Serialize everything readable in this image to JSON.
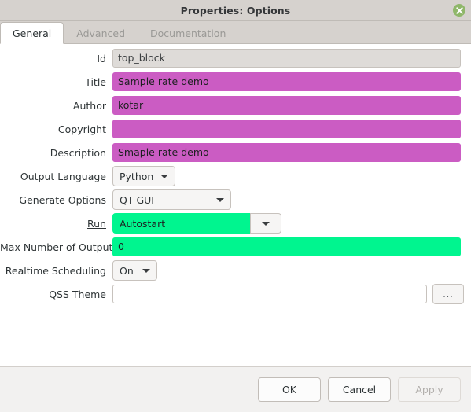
{
  "window": {
    "title": "Properties: Options",
    "close_icon": "close-circle-icon"
  },
  "tabs": [
    {
      "label": "General",
      "active": true
    },
    {
      "label": "Advanced",
      "active": false
    },
    {
      "label": "Documentation",
      "active": false
    }
  ],
  "form": {
    "rows": [
      {
        "label": "Id",
        "value": "top_block",
        "kind": "readonly-input"
      },
      {
        "label": "Title",
        "value": "Sample rate demo",
        "kind": "edited-input"
      },
      {
        "label": "Author",
        "value": "kotar",
        "kind": "edited-input"
      },
      {
        "label": "Copyright",
        "value": "",
        "kind": "edited-input"
      },
      {
        "label": "Description",
        "value": "Smaple rate demo",
        "kind": "edited-input"
      },
      {
        "label": "Output Language",
        "value": "Python",
        "kind": "combo"
      },
      {
        "label": "Generate Options",
        "value": "QT GUI",
        "kind": "combo"
      },
      {
        "label": "Run",
        "value": "Autostart",
        "kind": "combo-split",
        "underlined": true
      },
      {
        "label": "Max Number of Output",
        "value": "0",
        "kind": "green-input"
      },
      {
        "label": "Realtime Scheduling",
        "value": "On",
        "kind": "combo"
      },
      {
        "label": "QSS Theme",
        "value": "",
        "kind": "file-input",
        "browse_label": "..."
      }
    ]
  },
  "footer": {
    "ok_label": "OK",
    "cancel_label": "Cancel",
    "apply_label": "Apply"
  },
  "colors": {
    "edited_field": "#cb5cc3",
    "green_field": "#00f58f",
    "readonly_field": "#dedbd8",
    "titlebar": "#d6d2ce",
    "close_button": "#8fb76a"
  }
}
